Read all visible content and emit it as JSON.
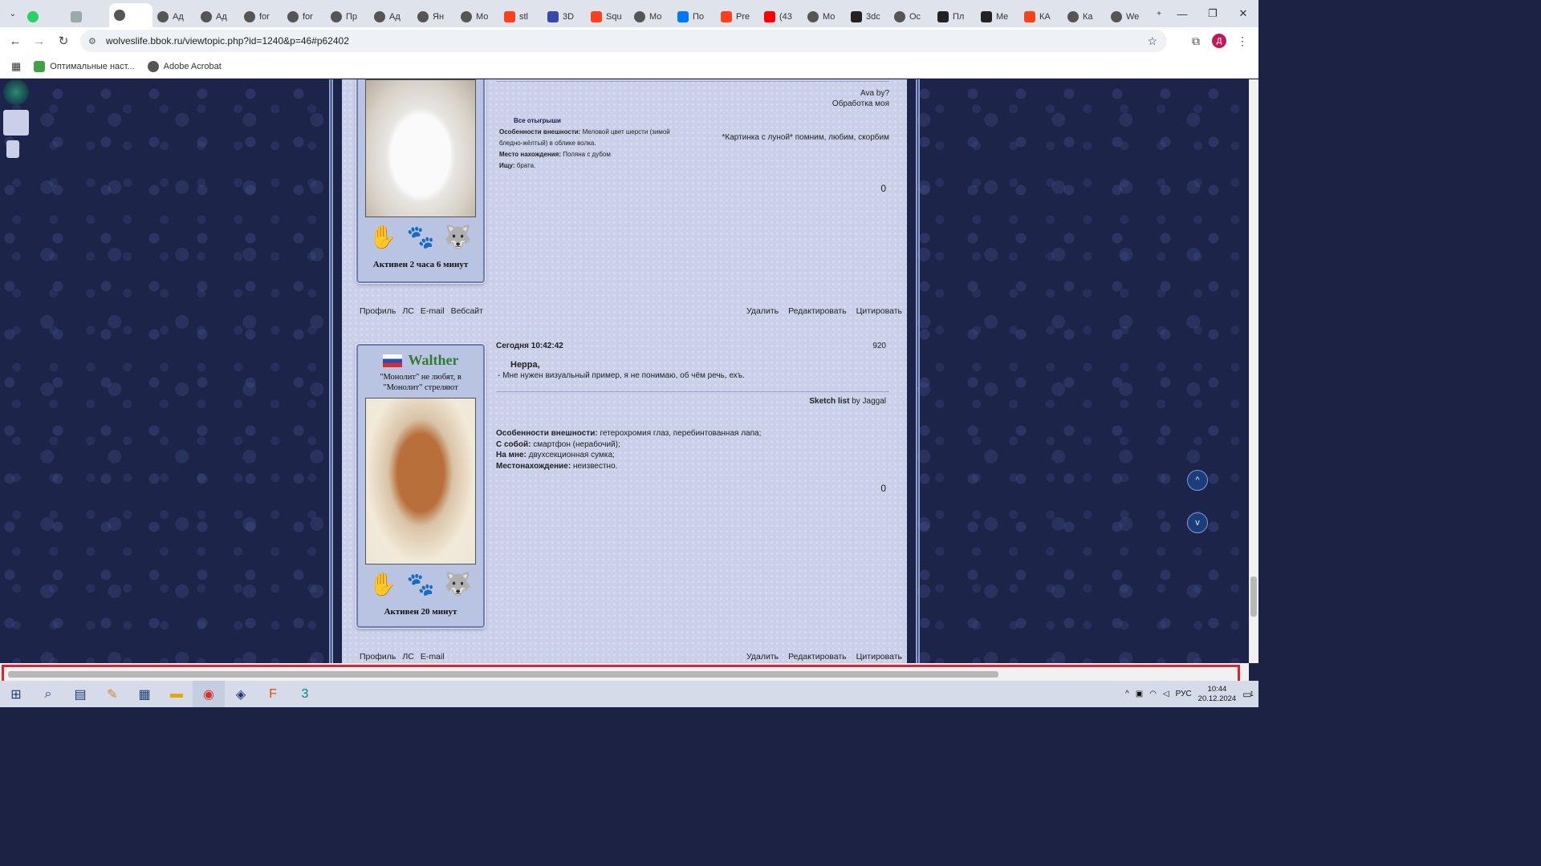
{
  "browser": {
    "tabs": [
      {
        "label": "",
        "icon": "whatsapp-icon"
      },
      {
        "label": "",
        "icon": "page-icon"
      },
      {
        "label": "",
        "icon": "globe-icon",
        "active": true
      },
      {
        "label": "Ад",
        "icon": "globe-icon"
      },
      {
        "label": "Ад",
        "icon": "globe-icon"
      },
      {
        "label": "for",
        "icon": "globe-icon"
      },
      {
        "label": "for",
        "icon": "globe-icon"
      },
      {
        "label": "Пр",
        "icon": "globe-icon"
      },
      {
        "label": "Ад",
        "icon": "globe-icon"
      },
      {
        "label": "Ян",
        "icon": "globe-icon"
      },
      {
        "label": "Мо",
        "icon": "globe-icon"
      },
      {
        "label": "stl",
        "icon": "yandex-icon"
      },
      {
        "label": "3D",
        "icon": "grid-icon"
      },
      {
        "label": "Squ",
        "icon": "yandex-icon"
      },
      {
        "label": "Мо",
        "icon": "globe-icon"
      },
      {
        "label": "По",
        "icon": "vk-icon"
      },
      {
        "label": "Pre",
        "icon": "yandex-icon"
      },
      {
        "label": "(43",
        "icon": "youtube-icon"
      },
      {
        "label": "Мо",
        "icon": "globe-icon"
      },
      {
        "label": "3dc",
        "icon": "3d-icon"
      },
      {
        "label": "Ос",
        "icon": "globe-icon"
      },
      {
        "label": "Пл",
        "icon": "3d-icon"
      },
      {
        "label": "Me",
        "icon": "3d-icon"
      },
      {
        "label": "КА",
        "icon": "yandex-icon"
      },
      {
        "label": "Ка",
        "icon": "globe-icon"
      },
      {
        "label": "We",
        "icon": "globe-icon"
      }
    ],
    "new_tab": "+",
    "url": "wolveslife.bbok.ru/viewtopic.php?id=1240&p=46#p62402",
    "profile_initial": "Д",
    "bookmarks": [
      "Оптимальные наст...",
      "Adobe Acrobat"
    ]
  },
  "post1": {
    "sig_line1": "Ava by?",
    "sig_line2": "Обработка моя",
    "rp_title": "Все отыгрыши",
    "appearance_label": "Особенности внешности:",
    "appearance_value": "Меловой цвет шерсти (зимой бледно-жёлтый) в облике волка.",
    "location_label": "Место нахождения:",
    "location_value": "Поляна с дубом",
    "looking_label": "Ищу:",
    "looking_value": "брата.",
    "moon_text": "*Картинка с луной* помним, любим, скорбим",
    "rep": "0",
    "active": "Активен 2 часа 6 минут",
    "links": [
      "Профиль",
      "ЛС",
      "E-mail",
      "Вебсайт"
    ],
    "actions": [
      "Удалить",
      "Редактировать",
      "Цитировать"
    ]
  },
  "post2": {
    "username": "Walther",
    "title": "\"Монолит\" не любят, в \"Монолит\" стреляют",
    "date": "Сегодня 10:42:42",
    "post_no": "920",
    "addressee": "Нерра,",
    "text": "- Мне нужен визуальный пример, я не понимаю, об чём речь, ехъ.",
    "sketch_label": "Sketch list",
    "sketch_by": "by Jaggal",
    "appearance_label": "Особенности внешности:",
    "appearance_value": "гетерохромия глаз, перебинтованная лапа;",
    "carry_label": "С собой:",
    "carry_value": "смартфон (нерабочий);",
    "wear_label": "На мне:",
    "wear_value": "двухсекционная сумка;",
    "loc_label": "Местонахождение:",
    "loc_value": "неизвестно.",
    "rep": "0",
    "active": "Активен 20 минут",
    "links": [
      "Профиль",
      "ЛС",
      "E-mail"
    ],
    "actions": [
      "Удалить",
      "Редактировать",
      "Цитировать"
    ]
  },
  "taskbar": {
    "lang": "РУС",
    "time": "10:44",
    "date": "20.12.2024",
    "notif_count": "1"
  },
  "colors": {
    "accent_red": "#e3202f",
    "forum_bg": "#c9d0e8",
    "username_green": "#2e7d32"
  }
}
